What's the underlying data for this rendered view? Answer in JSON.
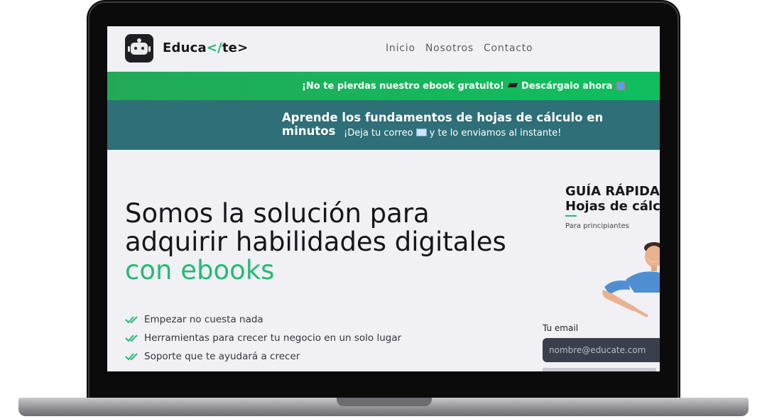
{
  "brand": {
    "name_prefix": "Educa",
    "name_slash": "</",
    "name_suffix": "te>"
  },
  "nav": {
    "items": [
      "Inicio",
      "Nosotros",
      "Contacto"
    ]
  },
  "promo_banner": {
    "text": "¡No te pierdas nuestro ebook gratuito!",
    "cta": "Descárgalo ahora"
  },
  "info_banner": {
    "title": "Aprende los fundamentos de hojas de cálculo en minutos",
    "subtitle_a": "¡Deja tu correo",
    "subtitle_b": "y te lo enviamos al instante!"
  },
  "hero": {
    "line1": "Somos la solución para",
    "line2": "adquirir habilidades digitales",
    "accent": "con ebooks"
  },
  "features": [
    "Empezar no cuesta nada",
    "Herramientas para crecer tu negocio en un solo lugar",
    "Soporte que te ayudará a crecer"
  ],
  "guide": {
    "title_line1": "GUÍA RÁPIDA",
    "title_line2": "Hojas de cálc",
    "subtitle": "Para principiantes"
  },
  "form": {
    "email_label": "Tu email",
    "email_placeholder": "nombre@educate.com"
  },
  "colors": {
    "accent_green": "#27b974",
    "promo_green": "#22a958",
    "teal": "#2e6f78",
    "nav_bg": "#f0f0f5"
  }
}
